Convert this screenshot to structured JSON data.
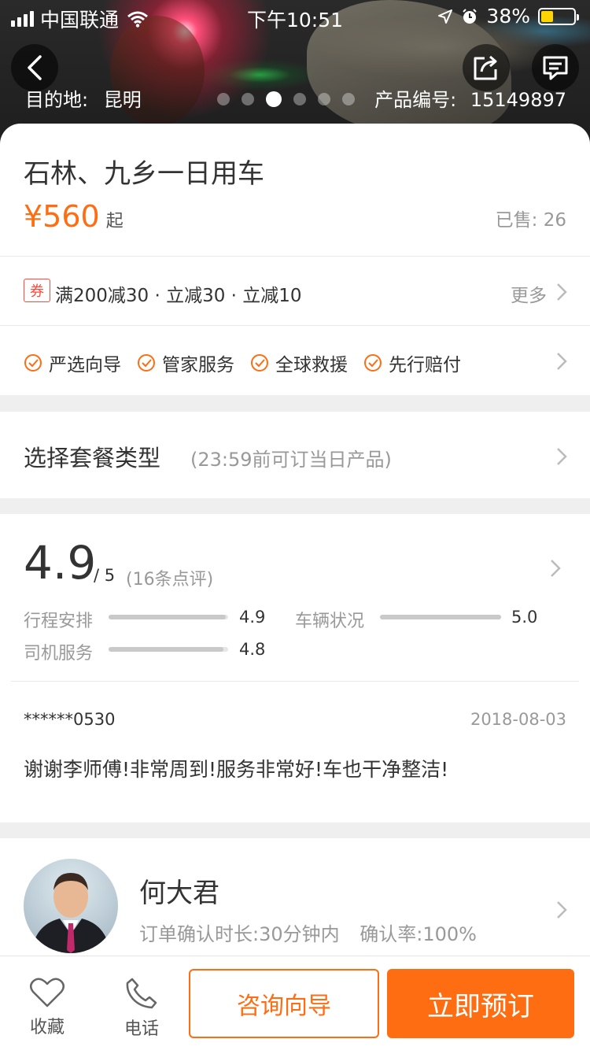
{
  "status_bar": {
    "carrier": "中国联通",
    "time": "下午10:51",
    "battery": "38%",
    "battery_level": 0.38,
    "icons": [
      "signal-icon",
      "wifi-icon",
      "location-icon",
      "alarm-icon",
      "battery-icon"
    ]
  },
  "hero": {
    "destination_label": "目的地:",
    "destination": "昆明",
    "product_no_label": "产品编号:",
    "product_no": "15149897",
    "carousel_count": 6,
    "carousel_active_index": 2,
    "icons": [
      "back-icon",
      "share-icon",
      "message-icon"
    ]
  },
  "product": {
    "title": "石林、九乡一日用车",
    "price": "¥560",
    "price_suffix": "起",
    "sold": "已售: 26"
  },
  "coupon": {
    "tag": "券",
    "text": "满200减30 · 立减30 · 立减10",
    "more": "更多"
  },
  "guarantees": [
    "严选向导",
    "管家服务",
    "全球救援",
    "先行赔付"
  ],
  "package": {
    "title": "选择套餐类型",
    "subtitle": "(23:59前可订当日产品)"
  },
  "rating": {
    "score": "4.9",
    "out_of": "/ 5",
    "count": "(16条点评)",
    "metrics": [
      {
        "label": "行程安排",
        "value": "4.9",
        "fraction": 0.98
      },
      {
        "label": "车辆状况",
        "value": "5.0",
        "fraction": 1.0
      },
      {
        "label": "司机服务",
        "value": "4.8",
        "fraction": 0.96
      }
    ]
  },
  "review": {
    "user": "******0530",
    "date": "2018-08-03",
    "text": "谢谢李师傅!非常周到!服务非常好!车也干净整洁!"
  },
  "guide": {
    "name": "何大君",
    "confirm_time": "订单确认时长:30分钟内",
    "confirm_rate": "确认率:100%"
  },
  "bottom_bar": {
    "favorite": "收藏",
    "phone": "电话",
    "consult": "咨询向导",
    "book": "立即预订"
  },
  "colors": {
    "accent": "#ff6d12",
    "coupon_red": "#ff4a3d",
    "muted_text": "#999999"
  }
}
